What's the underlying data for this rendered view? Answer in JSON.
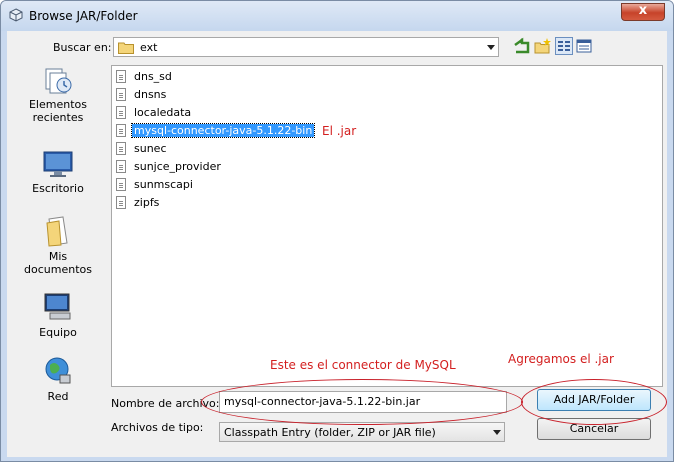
{
  "window": {
    "title": "Browse JAR/Folder",
    "close_glyph": "x"
  },
  "lookin": {
    "label": "Buscar en:",
    "value": "ext"
  },
  "toolbar": {
    "icons": [
      "up-folder-icon",
      "new-folder-icon",
      "list-view-icon",
      "details-view-icon"
    ]
  },
  "places": [
    {
      "label": "Elementos recientes",
      "icon": "recent-items-icon"
    },
    {
      "label": "Escritorio",
      "icon": "desktop-icon"
    },
    {
      "label": "Mis documentos",
      "icon": "documents-icon"
    },
    {
      "label": "Equipo",
      "icon": "computer-icon"
    },
    {
      "label": "Red",
      "icon": "network-icon"
    }
  ],
  "files": [
    {
      "name": "dns_sd",
      "selected": false
    },
    {
      "name": "dnsns",
      "selected": false
    },
    {
      "name": "localedata",
      "selected": false
    },
    {
      "name": "mysql-connector-java-5.1.22-bin",
      "selected": true
    },
    {
      "name": "sunec",
      "selected": false
    },
    {
      "name": "sunjce_provider",
      "selected": false
    },
    {
      "name": "sunmscapi",
      "selected": false
    },
    {
      "name": "zipfs",
      "selected": false
    }
  ],
  "annotations": {
    "jar_note": "El .jar",
    "connector_note": "Este es el connector de MySQL",
    "add_note": "Agregamos el .jar",
    "color": "#d31f1f"
  },
  "filename": {
    "label": "Nombre de archivo:",
    "value": "mysql-connector-java-5.1.22-bin.jar"
  },
  "filetype": {
    "label": "Archivos de tipo:",
    "value": "Classpath Entry (folder, ZIP or JAR file)"
  },
  "buttons": {
    "add": "Add JAR/Folder",
    "cancel": "Cancelar"
  }
}
